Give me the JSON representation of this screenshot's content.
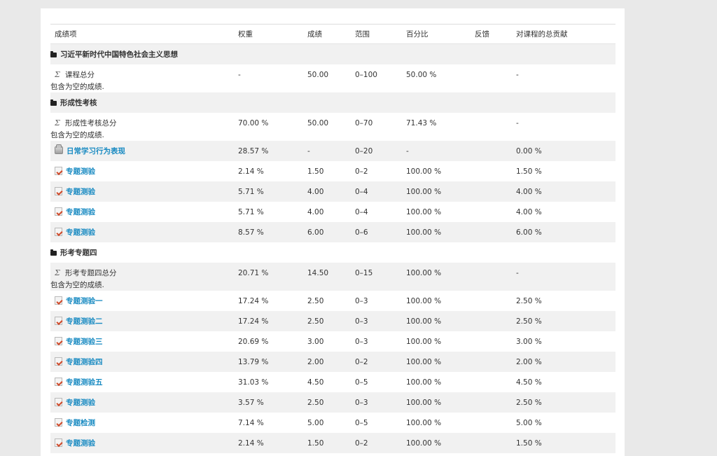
{
  "table": {
    "headers": {
      "item": "成绩项",
      "weight": "权重",
      "grade": "成绩",
      "range": "范围",
      "percentage": "百分比",
      "feedback": "反馈",
      "contribution": "对课程的总贡献"
    },
    "rows": [
      {
        "kind": "category",
        "level": 1,
        "name": "习近平新时代中国特色社会主义思想",
        "bg": "shade"
      },
      {
        "kind": "aggregate",
        "level": 1,
        "name": "课程总分",
        "note": "包含为空的成绩.",
        "weight": "-",
        "grade": "50.00",
        "range": "0–100",
        "percentage": "50.00 %",
        "feedback": "",
        "contribution": "-",
        "bg": "plain"
      },
      {
        "kind": "category",
        "level": 2,
        "name": "形成性考核",
        "bg": "shade"
      },
      {
        "kind": "aggregate",
        "level": 2,
        "name": "形成性考核总分",
        "note": "包含为空的成绩.",
        "weight": "70.00 %",
        "grade": "50.00",
        "range": "0–70",
        "percentage": "71.43 %",
        "feedback": "",
        "contribution": "-",
        "bg": "plain"
      },
      {
        "kind": "manual",
        "level": 2,
        "name": "日常学习行为表现",
        "weight": "28.57 %",
        "grade": "-",
        "range": "0–20",
        "percentage": "-",
        "feedback": "",
        "contribution": "0.00 %",
        "bg": "shade"
      },
      {
        "kind": "quiz",
        "level": 2,
        "name": "专题测验",
        "weight": "2.14 %",
        "grade": "1.50",
        "range": "0–2",
        "percentage": "100.00 %",
        "feedback": "",
        "contribution": "1.50 %",
        "bg": "plain"
      },
      {
        "kind": "quiz",
        "level": 2,
        "name": "专题测验",
        "weight": "5.71 %",
        "grade": "4.00",
        "range": "0–4",
        "percentage": "100.00 %",
        "feedback": "",
        "contribution": "4.00 %",
        "bg": "shade"
      },
      {
        "kind": "quiz",
        "level": 2,
        "name": "专题测验",
        "weight": "5.71 %",
        "grade": "4.00",
        "range": "0–4",
        "percentage": "100.00 %",
        "feedback": "",
        "contribution": "4.00 %",
        "bg": "plain"
      },
      {
        "kind": "quiz",
        "level": 2,
        "name": "专题测验",
        "weight": "8.57 %",
        "grade": "6.00",
        "range": "0–6",
        "percentage": "100.00 %",
        "feedback": "",
        "contribution": "6.00 %",
        "bg": "shade"
      },
      {
        "kind": "category",
        "level": 3,
        "name": "形考专题四",
        "bg": "plain"
      },
      {
        "kind": "aggregate",
        "level": 3,
        "name": "形考专题四总分",
        "note": "包含为空的成绩.",
        "weight": "20.71 %",
        "grade": "14.50",
        "range": "0–15",
        "percentage": "100.00 %",
        "feedback": "",
        "contribution": "-",
        "bg": "shade"
      },
      {
        "kind": "quiz",
        "level": 3,
        "name": "专题测验一",
        "weight": "17.24 %",
        "grade": "2.50",
        "range": "0–3",
        "percentage": "100.00 %",
        "feedback": "",
        "contribution": "2.50 %",
        "bg": "plain"
      },
      {
        "kind": "quiz",
        "level": 3,
        "name": "专题测验二",
        "weight": "17.24 %",
        "grade": "2.50",
        "range": "0–3",
        "percentage": "100.00 %",
        "feedback": "",
        "contribution": "2.50 %",
        "bg": "shade"
      },
      {
        "kind": "quiz",
        "level": 3,
        "name": "专题测验三",
        "weight": "20.69 %",
        "grade": "3.00",
        "range": "0–3",
        "percentage": "100.00 %",
        "feedback": "",
        "contribution": "3.00 %",
        "bg": "plain"
      },
      {
        "kind": "quiz",
        "level": 3,
        "name": "专题测验四",
        "weight": "13.79 %",
        "grade": "2.00",
        "range": "0–2",
        "percentage": "100.00 %",
        "feedback": "",
        "contribution": "2.00 %",
        "bg": "shade"
      },
      {
        "kind": "quiz",
        "level": 3,
        "name": "专题测验五",
        "weight": "31.03 %",
        "grade": "4.50",
        "range": "0–5",
        "percentage": "100.00 %",
        "feedback": "",
        "contribution": "4.50 %",
        "bg": "plain"
      },
      {
        "kind": "quiz",
        "level": 2,
        "name": "专题测验",
        "weight": "3.57 %",
        "grade": "2.50",
        "range": "0–3",
        "percentage": "100.00 %",
        "feedback": "",
        "contribution": "2.50 %",
        "bg": "shade"
      },
      {
        "kind": "quiz",
        "level": 2,
        "name": "专题检测",
        "weight": "7.14 %",
        "grade": "5.00",
        "range": "0–5",
        "percentage": "100.00 %",
        "feedback": "",
        "contribution": "5.00 %",
        "bg": "plain"
      },
      {
        "kind": "quiz",
        "level": 2,
        "name": "专题测验",
        "weight": "2.14 %",
        "grade": "1.50",
        "range": "0–2",
        "percentage": "100.00 %",
        "feedback": "",
        "contribution": "1.50 %",
        "bg": "shade"
      }
    ]
  },
  "icons": {
    "category": "folder-icon",
    "aggregate": "sigma-icon",
    "manual": "manual-grade-icon",
    "quiz": "quiz-icon"
  },
  "colors": {
    "link": "#1a8bc2",
    "row_shade": "#f1f1f1",
    "page_bg": "#e9e9e9"
  }
}
